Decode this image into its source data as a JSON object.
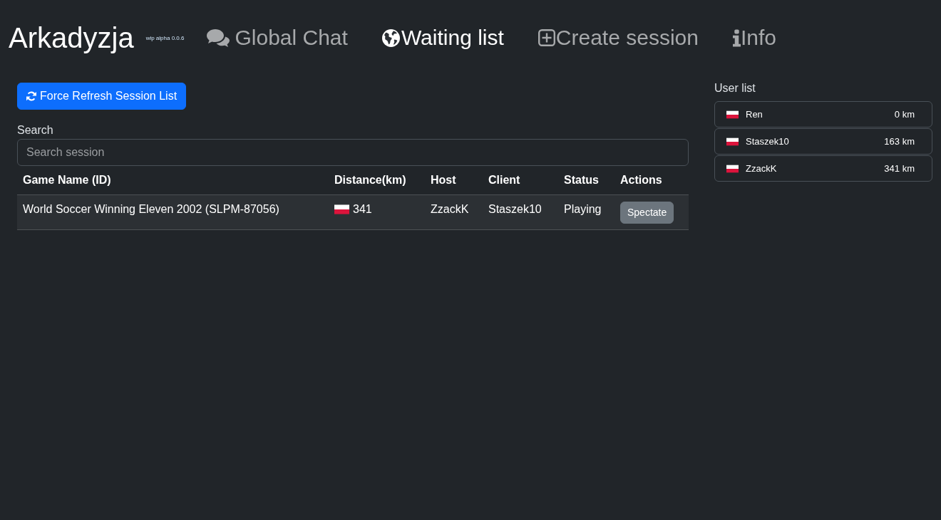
{
  "header": {
    "title": "Arkadyzja",
    "version": "wip alpha 0.0.6",
    "nav": [
      {
        "label": "Global Chat",
        "selected": false
      },
      {
        "label": "Waiting list",
        "selected": true
      },
      {
        "label": "Create session",
        "selected": false
      },
      {
        "label": "Info",
        "selected": false
      }
    ]
  },
  "sessions": {
    "refresh_button": "Force Refresh Session List",
    "search": {
      "label": "Search",
      "placeholder": "Search session"
    },
    "table": {
      "columns": [
        "Game Name (ID)",
        "Distance(km)",
        "Host",
        "Client",
        "Status",
        "Actions"
      ],
      "rows": [
        {
          "game": "World Soccer Winning Eleven 2002 (SLPM-87056)",
          "distance": "341",
          "host": "ZzackK",
          "client": "Staszek10",
          "status": "Playing",
          "action": "Spectate"
        }
      ]
    }
  },
  "user_list": {
    "title": "User list",
    "users": [
      {
        "name": "Ren",
        "distance": "0 km"
      },
      {
        "name": "Staszek10",
        "distance": "163 km"
      },
      {
        "name": "ZzackK",
        "distance": "341 km"
      }
    ]
  }
}
